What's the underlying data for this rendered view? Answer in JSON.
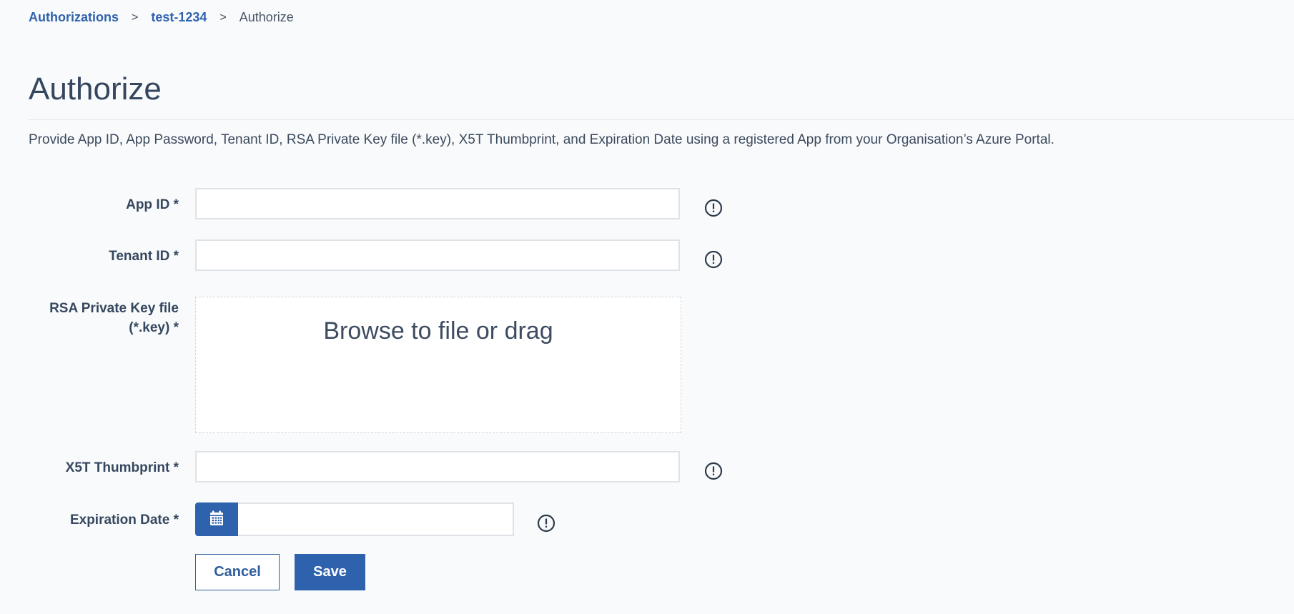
{
  "breadcrumb": {
    "items": [
      "Authorizations",
      "test-1234"
    ],
    "separator": ">",
    "current": "Authorize"
  },
  "page": {
    "title": "Authorize",
    "description": "Provide App ID, App Password, Tenant ID, RSA Private Key file (*.key), X5T Thumbprint, and Expiration Date using a registered App from your Organisation’s Azure Portal."
  },
  "form": {
    "app_id": {
      "label": "App ID *",
      "value": "",
      "placeholder": ""
    },
    "tenant_id": {
      "label": "Tenant ID *",
      "value": "",
      "placeholder": ""
    },
    "rsa_key": {
      "label_line1": "RSA Private Key file",
      "label_line2": "(*.key) *",
      "drop_text": "Browse to file or drag"
    },
    "x5t": {
      "label": "X5T Thumbprint *",
      "value": "",
      "placeholder": ""
    },
    "expiration": {
      "label": "Expiration Date *",
      "value": "",
      "placeholder": ""
    }
  },
  "actions": {
    "cancel_label": "Cancel",
    "save_label": "Save"
  },
  "icons": {
    "info": "info-circle-icon",
    "calendar": "calendar-icon"
  },
  "colors": {
    "accent": "#2f62ad",
    "text": "#3b4a5c",
    "background": "#f9fafc"
  }
}
